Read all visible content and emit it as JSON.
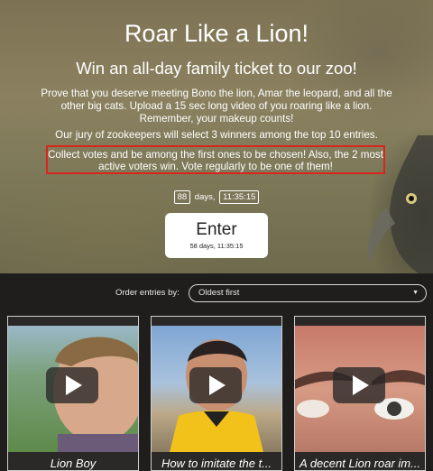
{
  "hero": {
    "title": "Roar Like a Lion!",
    "subtitle": "Win an all-day family ticket to our zoo!",
    "paragraph1": "Prove that you deserve meeting Bono the lion, Amar the leopard, and all the other big cats. Upload a 15 sec long video of you roaring like a lion. Remember, your makeup counts!",
    "paragraph2": "Our jury of zookeepers will select 3 winners among the top 10 entries.",
    "callout": "Collect votes and be among the first ones to be chosen! Also, the 2 most active voters win. Vote regularly to be one of them!"
  },
  "countdown": {
    "days_value": "88",
    "days_label": "days,",
    "time_value": "11:35:15"
  },
  "enter_button": {
    "label": "Enter",
    "sub": "58 days, 11:35:15"
  },
  "order": {
    "label": "Order entries by:",
    "selected": "Oldest first"
  },
  "entries": [
    {
      "caption": "Lion Boy"
    },
    {
      "caption": "How to imitate the t..."
    },
    {
      "caption": "A decent Lion roar im..."
    }
  ],
  "icons": {
    "play": "play-icon",
    "dropdown": "chevron-down-icon"
  },
  "colors": {
    "callout_border": "#d9261c",
    "background_dark": "#1f1e1c"
  }
}
